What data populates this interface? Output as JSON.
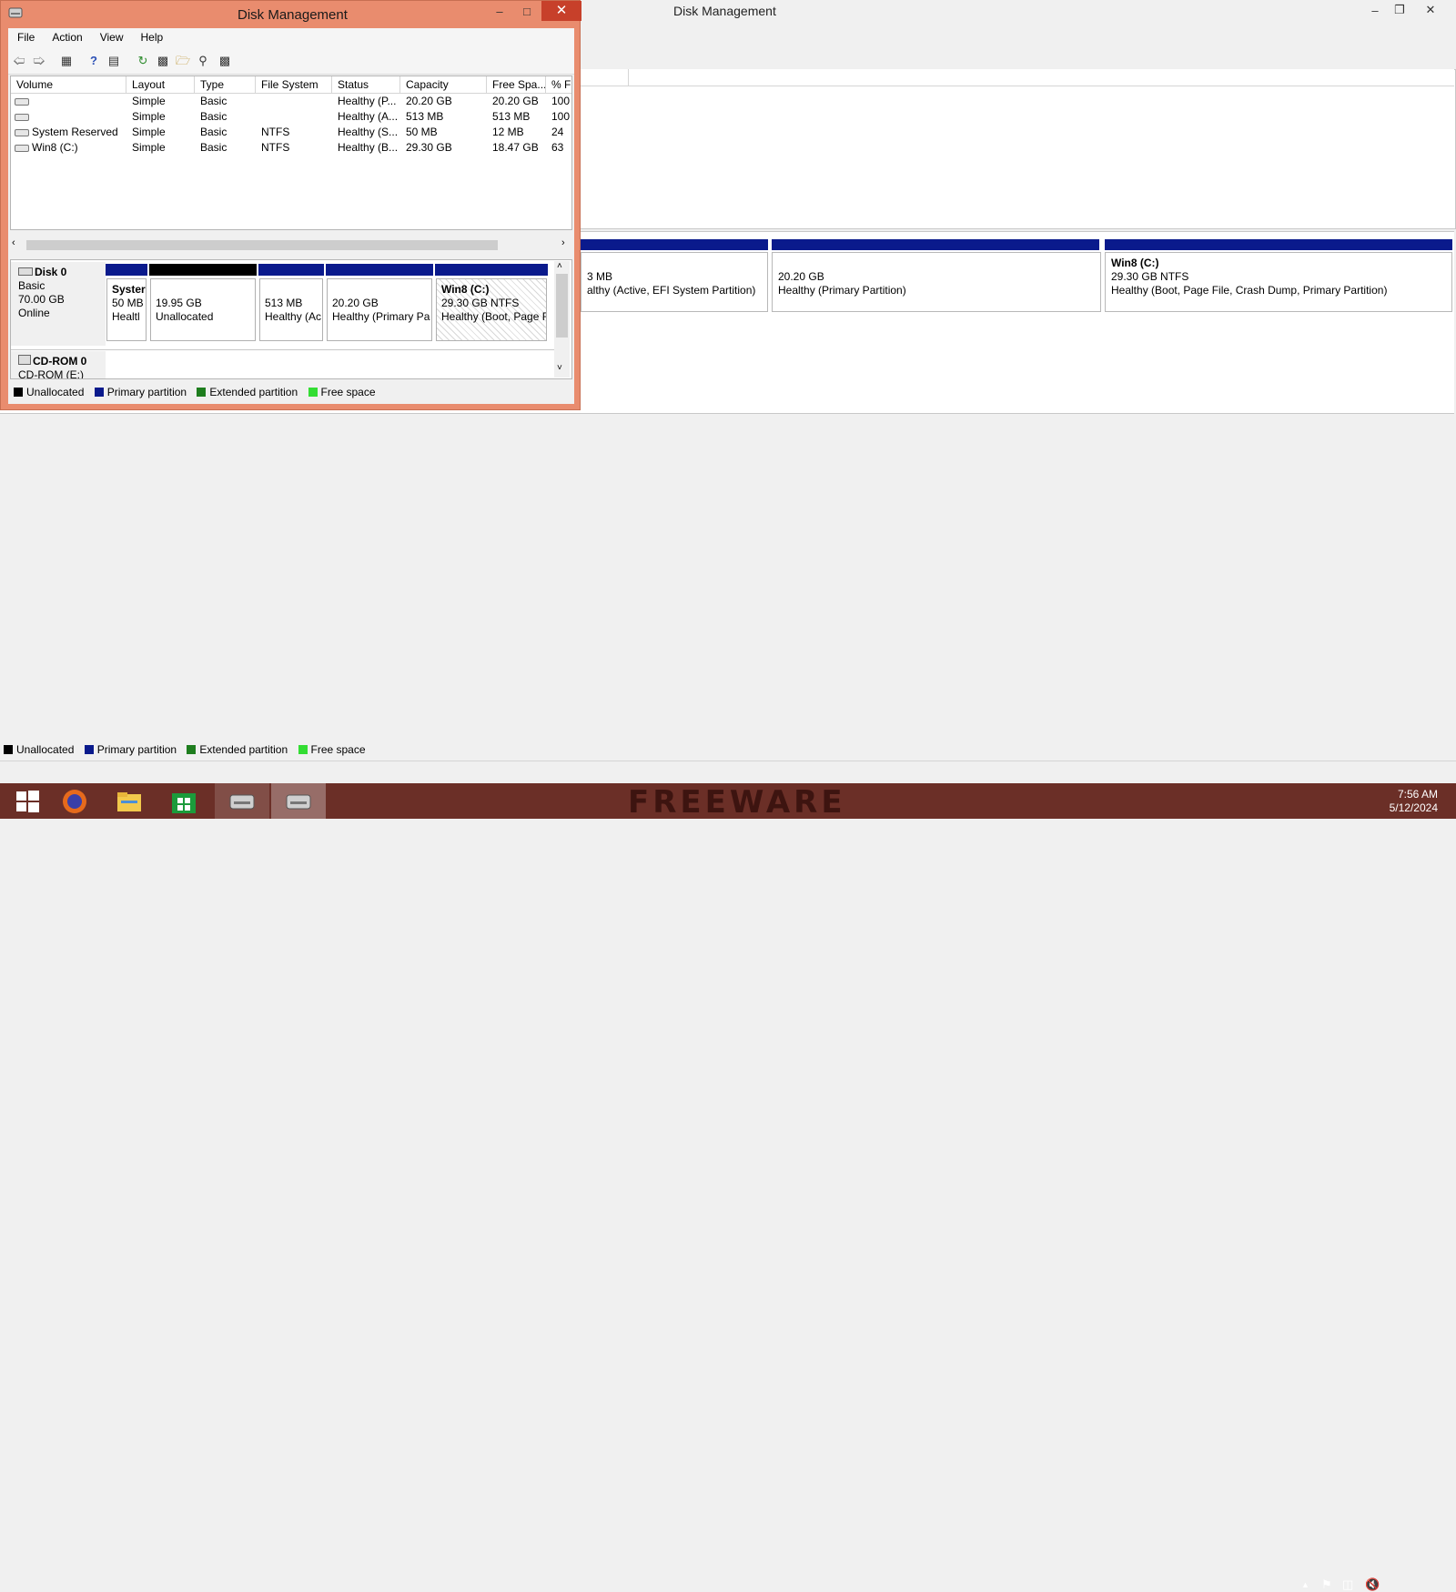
{
  "background_window": {
    "title": "Disk Management",
    "partitions": [
      {
        "line1": "3 MB",
        "line2": "althy (Active, EFI System Partition)"
      },
      {
        "line1": "20.20 GB",
        "line2": "Healthy (Primary Partition)"
      },
      {
        "title": "Win8  (C:)",
        "line1": "29.30 GB NTFS",
        "line2": "Healthy (Boot, Page File, Crash Dump, Primary Partition)"
      }
    ]
  },
  "window": {
    "title": "Disk Management",
    "menu": [
      "File",
      "Action",
      "View",
      "Help"
    ]
  },
  "volume_table": {
    "columns": [
      "Volume",
      "Layout",
      "Type",
      "File System",
      "Status",
      "Capacity",
      "Free Spa...",
      "% F"
    ],
    "rows": [
      {
        "volume": "",
        "layout": "Simple",
        "type": "Basic",
        "fs": "",
        "status": "Healthy (P...",
        "capacity": "20.20 GB",
        "free": "20.20 GB",
        "pct": "100"
      },
      {
        "volume": "",
        "layout": "Simple",
        "type": "Basic",
        "fs": "",
        "status": "Healthy (A...",
        "capacity": "513 MB",
        "free": "513 MB",
        "pct": "100"
      },
      {
        "volume": "System Reserved",
        "layout": "Simple",
        "type": "Basic",
        "fs": "NTFS",
        "status": "Healthy (S...",
        "capacity": "50 MB",
        "free": "12 MB",
        "pct": "24"
      },
      {
        "volume": "Win8 (C:)",
        "layout": "Simple",
        "type": "Basic",
        "fs": "NTFS",
        "status": "Healthy (B...",
        "capacity": "29.30 GB",
        "free": "18.47 GB",
        "pct": "63"
      }
    ]
  },
  "disk0": {
    "name": "Disk 0",
    "type": "Basic",
    "size": "70.00 GB",
    "state": "Online",
    "partitions": [
      {
        "title": "Syster",
        "line1": "50 MB",
        "line2": "Healtl"
      },
      {
        "line1": "19.95 GB",
        "line2": "Unallocated"
      },
      {
        "line1": "513 MB",
        "line2": "Healthy (Ac"
      },
      {
        "line1": "20.20 GB",
        "line2": "Healthy (Primary Pa"
      },
      {
        "title": "Win8  (C:)",
        "line1": "29.30 GB NTFS",
        "line2": "Healthy (Boot, Page F"
      }
    ]
  },
  "cdrom0": {
    "name": "CD-ROM 0",
    "type": "CD-ROM (E:)"
  },
  "legend": [
    "Unallocated",
    "Primary partition",
    "Extended partition",
    "Free space"
  ],
  "legend_colors": {
    "unallocated": "#000000",
    "primary": "#0a1a8c",
    "extended": "#1e7d1e",
    "free": "#33dd33"
  },
  "taskbar": {
    "watermark": "FREEWARE",
    "time": "7:56 AM",
    "date": "5/12/2024",
    "icons": [
      "start-icon",
      "firefox-icon",
      "file-explorer-icon",
      "store-icon",
      "disk-management-icon",
      "disk-management-icon"
    ]
  }
}
